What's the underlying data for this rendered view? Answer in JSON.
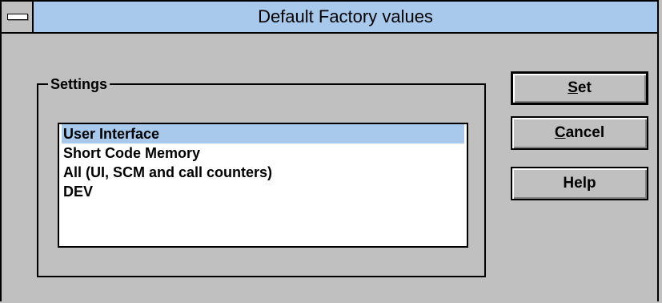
{
  "window": {
    "title": "Default Factory values",
    "system_menu_icon": "system-menu-icon"
  },
  "settings": {
    "group_label": "Settings",
    "items": [
      {
        "label": "User Interface",
        "selected": true
      },
      {
        "label": "Short Code Memory",
        "selected": false
      },
      {
        "label": "All (UI, SCM and call counters)",
        "selected": false
      },
      {
        "label": "DEV",
        "selected": false
      }
    ]
  },
  "buttons": {
    "set": {
      "mnemonic": "S",
      "rest": "et"
    },
    "cancel": {
      "mnemonic": "C",
      "rest": "ancel"
    },
    "help": {
      "label": "Help"
    }
  },
  "colors": {
    "title_bar": "#a9c9ec",
    "selection": "#a9c9ec",
    "face": "#c0c0c0"
  }
}
